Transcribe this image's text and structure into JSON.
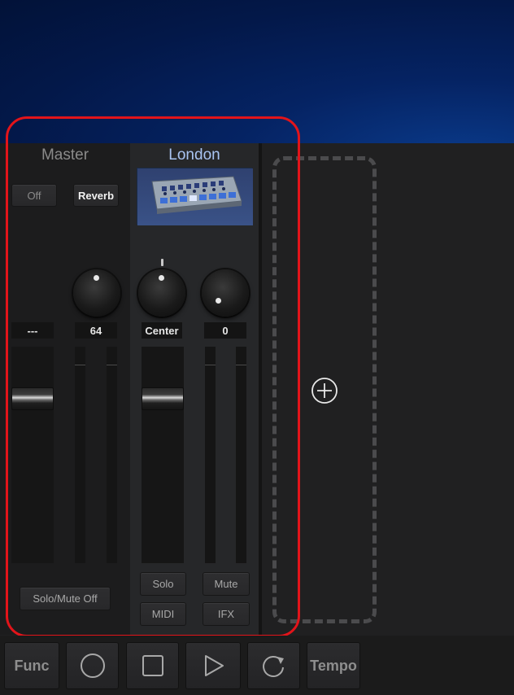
{
  "master": {
    "title": "Master",
    "send_off_label": "Off",
    "reverb_label": "Reverb",
    "left_value": "---",
    "reverb_value": "64",
    "solo_mute_label": "Solo/Mute Off"
  },
  "track": {
    "name": "London",
    "pan_value": "Center",
    "send_value": "0",
    "solo_label": "Solo",
    "mute_label": "Mute",
    "midi_label": "MIDI",
    "ifx_label": "IFX"
  },
  "toolbar": {
    "func_label": "Func",
    "record_icon": "record-icon",
    "stop_icon": "stop-icon",
    "play_icon": "play-icon",
    "loop_icon": "loop-icon",
    "tempo_label": "Tempo"
  },
  "colors": {
    "highlight": "#e2141a",
    "track_title": "#a9c4f2",
    "master_title": "#8a8a8a",
    "top_background": "#031849"
  }
}
